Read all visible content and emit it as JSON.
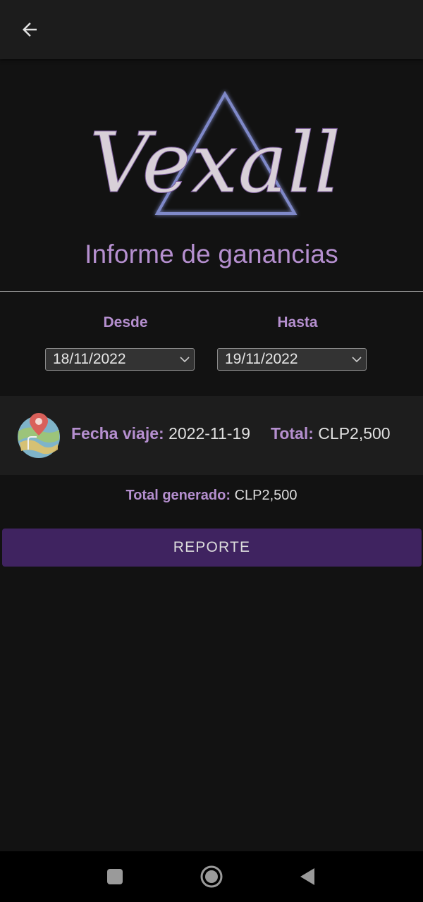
{
  "app": {
    "logo_text": "Vexall",
    "title": "Informe de ganancias"
  },
  "topbar": {
    "back_icon": "arrow-left-icon"
  },
  "filters": {
    "from_label": "Desde",
    "from_value": "18/11/2022",
    "to_label": "Hasta",
    "to_value": "19/11/2022"
  },
  "trips": [
    {
      "icon": "map-icon",
      "date_label": "Fecha viaje:",
      "date_value": "2022-11-19",
      "total_label": "Total:",
      "total_value": "CLP2,500"
    }
  ],
  "summary": {
    "label": "Total generado:",
    "value": "CLP2,500"
  },
  "report_button": "REPORTE",
  "system_nav": {
    "recents_icon": "square-icon",
    "home_icon": "circle-icon",
    "back_icon": "triangle-back-icon"
  },
  "colors": {
    "accent": "#b58fcf",
    "button": "#3f2360",
    "background": "#121212"
  }
}
